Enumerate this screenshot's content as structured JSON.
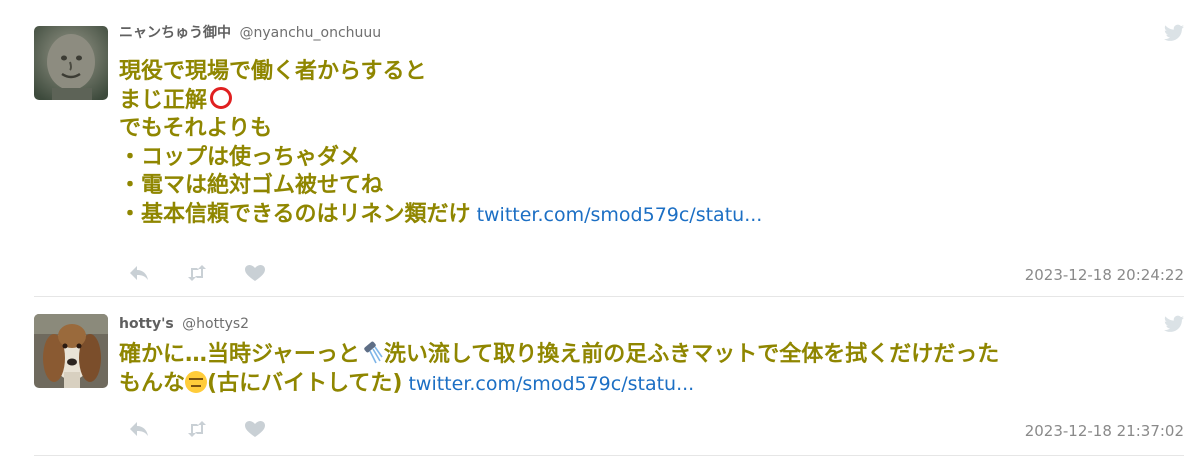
{
  "tweets": [
    {
      "name": "ニャンちゅう御中",
      "handle": "@nyanchu_onchuuu",
      "lines": [
        "現役で現場で働く者からすると",
        "まじ正解",
        "でもそれよりも",
        "・コップは使っちゃダメ",
        "・電マは絶対ゴム被せてね",
        "・基本信頼できるのはリネン類だけ"
      ],
      "link": "twitter.com/smod579c/statu...",
      "timestamp": "2023-12-18 20:24:22",
      "avatar_icon": "stone-statue-avatar",
      "emoji": "red-circle-emoji"
    },
    {
      "name": "hotty's",
      "handle": "@hottys2",
      "lines": [
        "確かに…当時ジャーっと",
        "洗い流して取り換え前の足ふきマットで全体を拭くだけだった",
        "もんな",
        "(古にバイトしてた)"
      ],
      "link": "twitter.com/smod579c/statu...",
      "timestamp": "2023-12-18 21:37:02",
      "avatar_icon": "basset-hound-avatar",
      "emoji": [
        "shower-emoji",
        "expressionless-face-emoji"
      ]
    }
  ],
  "colors": {
    "body_text": "#8f8600",
    "link": "#1c6fc4",
    "name": "#606060",
    "handle": "#6f6f6f",
    "timestamp": "#8a8a8a",
    "action_icons": "#c9d0d5",
    "divider": "#e6e6e6"
  },
  "action_icons": [
    "reply-icon",
    "retweet-icon",
    "like-icon"
  ],
  "brand_icon": "twitter-bird-icon"
}
